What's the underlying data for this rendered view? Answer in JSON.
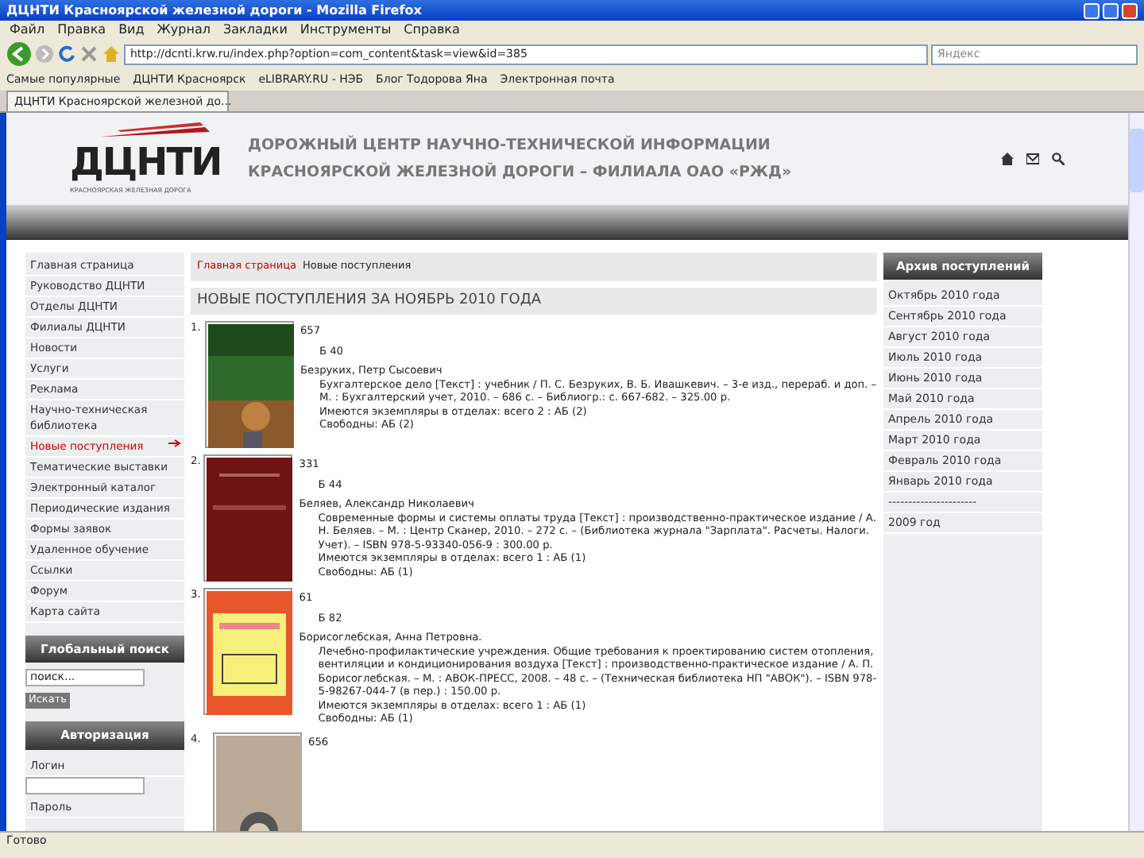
{
  "window": {
    "title": "ДЦНТИ Красноярской железной дороги - Mozilla Firefox"
  },
  "menu": [
    "Файл",
    "Правка",
    "Вид",
    "Журнал",
    "Закладки",
    "Инструменты",
    "Справка"
  ],
  "toolbar": {
    "url": "http://dcnti.krw.ru/index.php?option=com_content&task=view&id=385",
    "search_placeholder": "Яндекс"
  },
  "bookmarks": [
    "Самые популярные",
    "ДЦНТИ Красноярск",
    "eLIBRARY.RU - НЭБ",
    "Блог Тодорова Яна",
    "Электронная почта"
  ],
  "tabs": [
    {
      "label": "ДЦНТИ Красноярской железной до...",
      "selected": true
    }
  ],
  "site": {
    "logo": "ДЦНТИ",
    "logo_subtitle": "КРАСНОЯРСКАЯ ЖЕЛЕЗНАЯ ДОРОГА",
    "title_lines": [
      "ДОРОЖНЫЙ ЦЕНТР НАУЧНО-ТЕХНИЧЕСКОЙ ИНФОРМАЦИИ",
      "КРАСНОЯРСКОЙ ЖЕЛЕЗНОЙ ДОРОГИ – ФИЛИАЛА ОАО «РЖД»"
    ]
  },
  "left_menu": [
    {
      "label": "Главная страница",
      "selected": false
    },
    {
      "label": "Руководство ДЦНТИ",
      "selected": false
    },
    {
      "label": "Отделы ДЦНТИ",
      "selected": false
    },
    {
      "label": "Филиалы ДЦНТИ",
      "selected": false
    },
    {
      "label": "Новости",
      "selected": false
    },
    {
      "label": "Услуги",
      "selected": false
    },
    {
      "label": "Реклама",
      "selected": false
    },
    {
      "label": "Научно-техническая библиотека",
      "selected": false
    },
    {
      "label": "Новые поступления",
      "selected": true
    },
    {
      "label": "Тематические выставки",
      "selected": false
    },
    {
      "label": "Электронный каталог",
      "selected": false
    },
    {
      "label": "Периодические издания",
      "selected": false
    },
    {
      "label": "Формы заявок",
      "selected": false
    },
    {
      "label": "Удаленное обучение",
      "selected": false
    },
    {
      "label": "Ссылки",
      "selected": false
    },
    {
      "label": "Форум",
      "selected": false
    },
    {
      "label": "Карта сайта",
      "selected": false
    }
  ],
  "search_box": {
    "title": "Глобальный поиск",
    "value": "поиск...",
    "button": "Искать"
  },
  "login": {
    "title": "Авторизация",
    "username_label": "Логин",
    "password_label": "Пароль"
  },
  "breadcrumb": [
    "Главная страница",
    "Новые поступления"
  ],
  "heading": "НОВЫЕ ПОСТУПЛЕНИЯ ЗА НОЯБРЬ 2010 ГОДА",
  "entries": [
    {
      "number": "1.",
      "code": "657",
      "index": "Б 40",
      "author": "Безруких, Петр Сысоевич",
      "description": "Бухгалтерское дело [Текст] : учебник / П. С. Безруких, В. Б. Ивашкевич. – 3-е изд., перераб. и доп. – М. : Бухгалтерский учет, 2010. – 686 с. – Библиогр.: с. 667-682. – 325.00 р.",
      "copies": "Имеются экземпляры в отделах: всего 2 : АБ (2)",
      "available": "Свободны: АБ (2)"
    },
    {
      "number": "2.",
      "code": "331",
      "index": "Б 44",
      "author": "Беляев, Александр Николаевич",
      "description": "Современные формы и системы оплаты труда [Текст] : производственно-практическое издание / А. Н. Беляев. – М. : Центр Сканер, 2010. – 272 с. – (Библиотека журнала \"Зарплата\". Расчеты. Налоги. Учет). – ISBN 978-5-93340-056-9 : 300.00 р.",
      "copies": "Имеются экземпляры в отделах: всего 1 : АБ (1)",
      "available": "Свободны: АБ (1)"
    },
    {
      "number": "3.",
      "code": "61",
      "index": "Б 82",
      "author": "Борисоглебская, Анна Петровна.",
      "description": "Лечебно-профилактические учреждения. Общие требования к проектированию систем отопления, вентиляции и кондиционирования воздуха [Текст] : производственно-практическое издание / А. П. Борисоглебская. – М. : АВОК-ПРЕСС, 2008. – 48 с. – (Техническая библиотека НП \"АВОК\"). – ISBN 978-5-98267-044-7 (в пер.) : 150.00 р.",
      "copies": "Имеются экземпляры в отделах: всего 1 : АБ (1)",
      "available": "Свободны: АБ (1)"
    },
    {
      "number": "4.",
      "code": "656"
    }
  ],
  "archive": {
    "title": "Архив поступлений",
    "items": [
      "Октябрь 2010 года",
      "Сентябрь 2010 года",
      "Август 2010 года",
      "Июль 2010 года",
      "Июнь 2010 года",
      "Май 2010 года",
      "Апрель 2010 года",
      "Март 2010 года",
      "Февраль 2010 года",
      "Январь 2010 года"
    ],
    "separator": "----------------------",
    "last": "2009 год"
  },
  "status_bar": "Готово"
}
